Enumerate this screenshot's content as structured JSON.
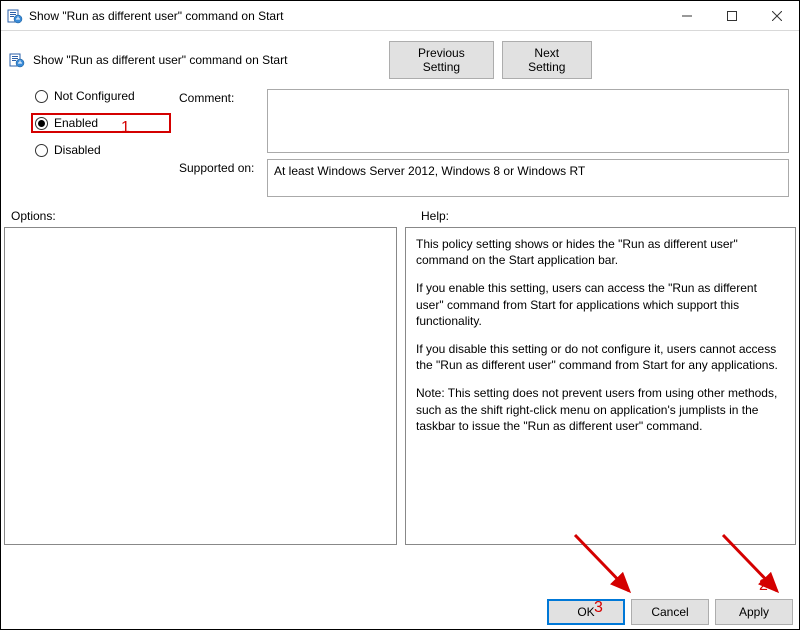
{
  "window": {
    "title": "Show \"Run as different user\" command on Start"
  },
  "header": {
    "title": "Show \"Run as different user\" command on Start",
    "prev_label": "Previous Setting",
    "next_label": "Next Setting"
  },
  "radios": {
    "not_configured": "Not Configured",
    "enabled": "Enabled",
    "disabled": "Disabled",
    "selected": "enabled"
  },
  "labels": {
    "comment": "Comment:",
    "supported_on": "Supported on:",
    "options": "Options:",
    "help": "Help:"
  },
  "fields": {
    "comment": "",
    "supported_on": "At least Windows Server 2012, Windows 8 or Windows RT"
  },
  "help": {
    "p1": "This policy setting shows or hides the \"Run as different user\" command on the Start application bar.",
    "p2": "If you enable this setting, users can access the \"Run as different user\" command from Start for applications which support this functionality.",
    "p3": "If you disable this setting or do not configure it, users cannot access the \"Run as different user\" command from Start for any applications.",
    "p4": "Note: This setting does not prevent users from using other methods, such as the shift right-click menu on application's jumplists in the taskbar to issue the \"Run as different user\" command."
  },
  "buttons": {
    "ok": "OK",
    "cancel": "Cancel",
    "apply": "Apply"
  },
  "annotations": {
    "n1": "1",
    "n2": "2",
    "n3": "3"
  }
}
